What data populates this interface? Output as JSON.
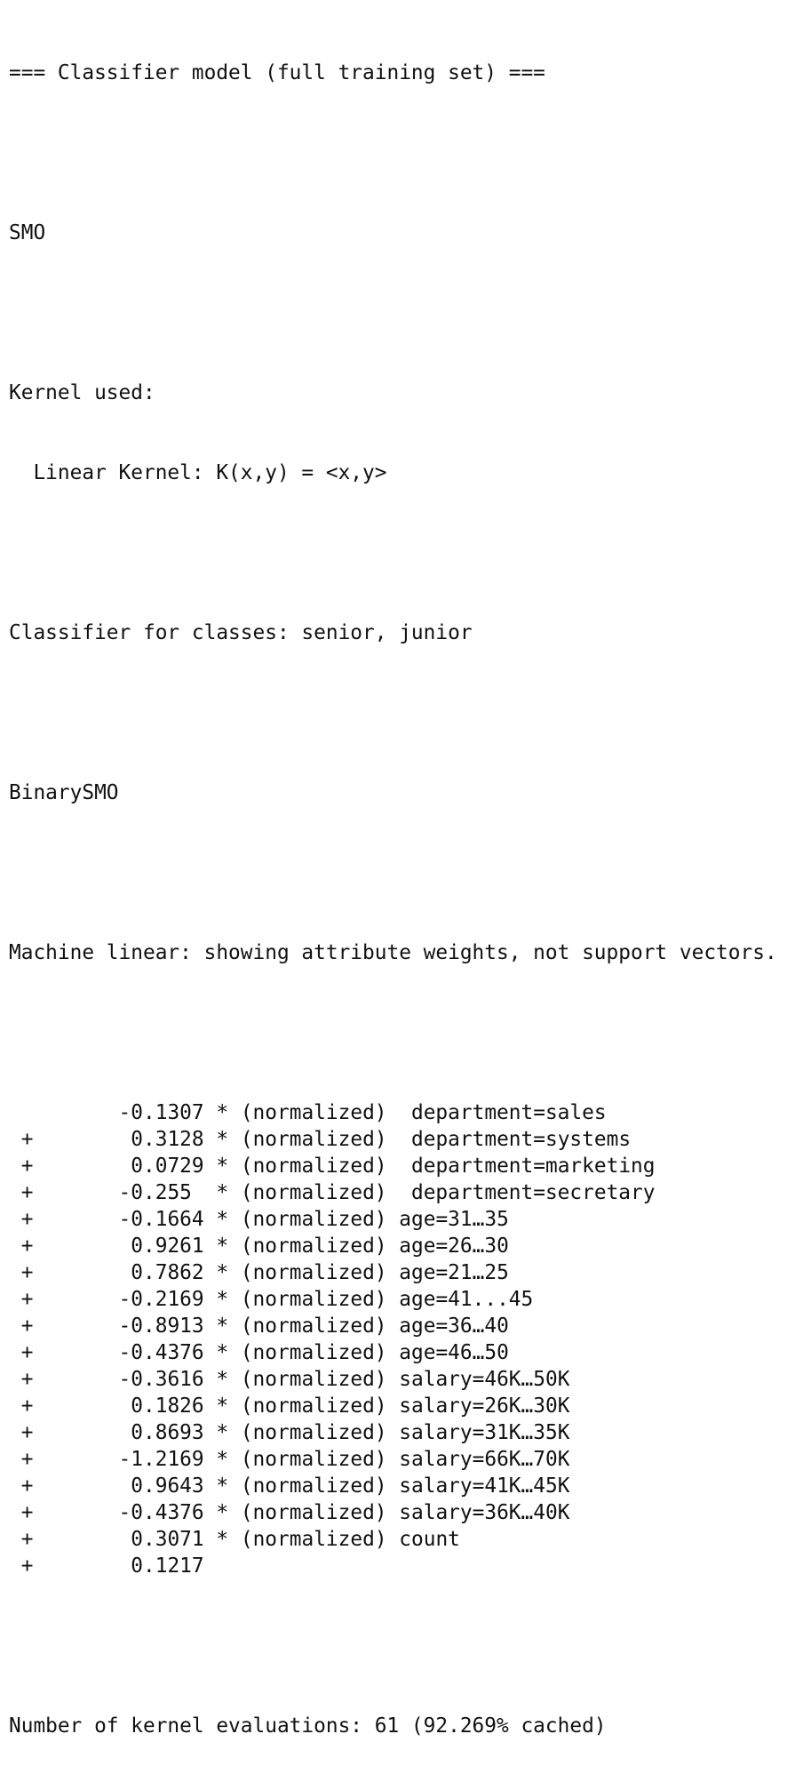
{
  "header": "=== Classifier model (full training set) ===",
  "classifier_name": "SMO",
  "kernel_label": "Kernel used:",
  "kernel_value": "Linear Kernel: K(x,y) = <x,y>",
  "classes_line": "Classifier for classes: senior, junior",
  "binary_name": "BinarySMO",
  "machine_line": "Machine linear: showing attribute weights, not support vectors.",
  "terms": [
    {
      "sign": "",
      "value": "-0.1307",
      "mult": "*",
      "norm": "(normalized)",
      "attribute": "department=sales"
    },
    {
      "sign": "+",
      "value": "0.3128",
      "mult": "*",
      "norm": "(normalized)",
      "attribute": "department=systems"
    },
    {
      "sign": "+",
      "value": "0.0729",
      "mult": "*",
      "norm": "(normalized)",
      "attribute": "department=marketing"
    },
    {
      "sign": "+",
      "value": "-0.255",
      "mult": "*",
      "norm": "(normalized)",
      "attribute": "department=secretary"
    },
    {
      "sign": "+",
      "value": "-0.1664",
      "mult": "*",
      "norm": "(normalized)",
      "attribute": "age=31…35"
    },
    {
      "sign": "+",
      "value": "0.9261",
      "mult": "*",
      "norm": "(normalized)",
      "attribute": "age=26…30"
    },
    {
      "sign": "+",
      "value": "0.7862",
      "mult": "*",
      "norm": "(normalized)",
      "attribute": "age=21…25"
    },
    {
      "sign": "+",
      "value": "-0.2169",
      "mult": "*",
      "norm": "(normalized)",
      "attribute": "age=41...45"
    },
    {
      "sign": "+",
      "value": "-0.8913",
      "mult": "*",
      "norm": "(normalized)",
      "attribute": "age=36…40"
    },
    {
      "sign": "+",
      "value": "-0.4376",
      "mult": "*",
      "norm": "(normalized)",
      "attribute": "age=46…50"
    },
    {
      "sign": "+",
      "value": "-0.3616",
      "mult": "*",
      "norm": "(normalized)",
      "attribute": "salary=46K…50K"
    },
    {
      "sign": "+",
      "value": "0.1826",
      "mult": "*",
      "norm": "(normalized)",
      "attribute": "salary=26K…30K"
    },
    {
      "sign": "+",
      "value": "0.8693",
      "mult": "*",
      "norm": "(normalized)",
      "attribute": "salary=31K…35K"
    },
    {
      "sign": "+",
      "value": "-1.2169",
      "mult": "*",
      "norm": "(normalized)",
      "attribute": "salary=66K…70K"
    },
    {
      "sign": "+",
      "value": "0.9643",
      "mult": "*",
      "norm": "(normalized)",
      "attribute": "salary=41K…45K"
    },
    {
      "sign": "+",
      "value": "-0.4376",
      "mult": "*",
      "norm": "(normalized)",
      "attribute": "salary=36K…40K"
    },
    {
      "sign": "+",
      "value": "0.3071",
      "mult": "*",
      "norm": "(normalized)",
      "attribute": "count"
    },
    {
      "sign": "+",
      "value": "0.1217",
      "mult": "",
      "norm": "",
      "attribute": ""
    }
  ],
  "evaluations_line": "Number of kernel evaluations: 61 (92.269% cached)"
}
